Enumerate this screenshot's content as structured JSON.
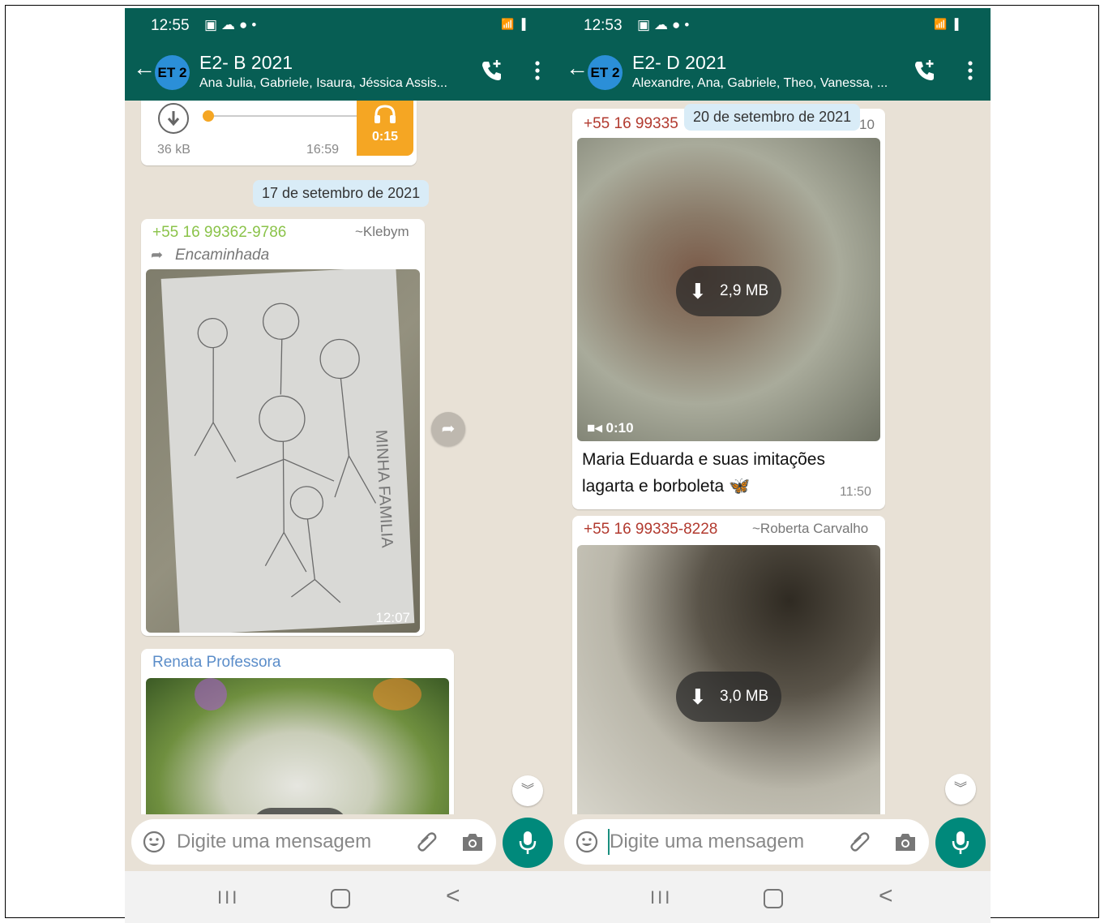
{
  "left": {
    "status": {
      "time": "12:55"
    },
    "header": {
      "avatar": "ET 2",
      "title": "E2- B 2021",
      "subtitle": "Ana Julia, Gabriele, Isaura, Jéssica Assis..."
    },
    "audio": {
      "size": "36 kB",
      "time": "16:59",
      "duration": "0:15"
    },
    "date_pill": "17 de setembro de 2021",
    "msg1": {
      "sender": "+55 16 99362-9786",
      "alias": "~Klebym",
      "forwarded": "Encaminhada",
      "time": "12:07"
    },
    "msg2": {
      "sender": "Renata Professora"
    },
    "input": {
      "placeholder": "Digite uma mensagem"
    }
  },
  "right": {
    "status": {
      "time": "12:53"
    },
    "header": {
      "avatar": "ET 2",
      "title": "E2- D 2021",
      "subtitle": "Alexandre, Ana, Gabriele, Theo, Vanessa, ..."
    },
    "date_pill": "20 de setembro de 2021",
    "msg1": {
      "sender": "+55 16 99335",
      "alias_tail": "10",
      "download": "2,9 MB",
      "video_duration": "0:10",
      "caption": "Maria Eduarda e suas imitações lagarta e borboleta",
      "caption_emoji": "🦋",
      "time": "11:50"
    },
    "msg2": {
      "sender": "+55 16 99335-8228",
      "alias": "~Roberta Carvalho",
      "download": "3,0 MB"
    },
    "input": {
      "placeholder": "Digite uma mensagem"
    }
  },
  "colors": {
    "header": "#075e54",
    "chat_bg": "#e8e1d6",
    "mic": "#00897b",
    "audio_orange": "#f5a623"
  },
  "icons": [
    "back-arrow-icon",
    "add-call-icon",
    "more-vert-icon",
    "download-icon",
    "headphones-icon",
    "forward-icon",
    "share-icon",
    "video-icon",
    "emoji-icon",
    "attach-icon",
    "camera-icon",
    "mic-icon",
    "chevron-down-icon"
  ]
}
